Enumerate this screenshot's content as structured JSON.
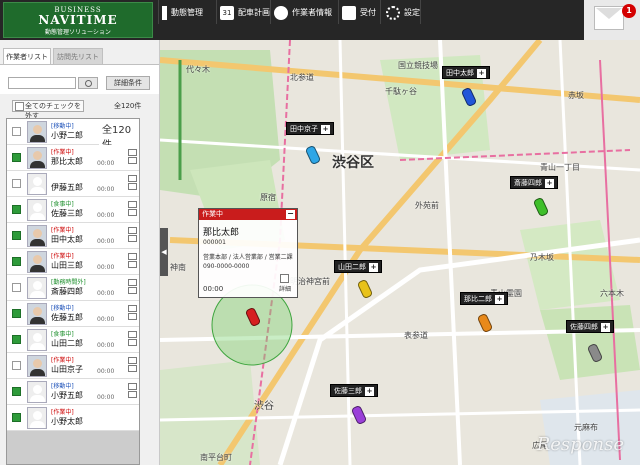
{
  "logo": {
    "line1": "BUSINESS",
    "line2": "NAVITIME",
    "line3": "動態管理ソリューション"
  },
  "nav": [
    {
      "label": "動態管理",
      "icon": "tracking-icon"
    },
    {
      "label": "配車計画",
      "icon": "calendar-icon"
    },
    {
      "label": "作業者情報",
      "icon": "person-icon"
    },
    {
      "label": "受付",
      "icon": "reception-icon"
    },
    {
      "label": "設定",
      "icon": "gear-icon"
    }
  ],
  "notifications": {
    "count": "1"
  },
  "sidebar": {
    "tabs": [
      "作業者リスト",
      "訪問先リスト"
    ],
    "detail_button": "詳細条件",
    "check_all": "全てのチェックを外す",
    "total_label": "全120件",
    "count_box": "全120件",
    "workers": [
      {
        "status": "[移動中]",
        "name": "小野二郎",
        "time": "",
        "checked": false,
        "photo": true
      },
      {
        "status": "[作業中]",
        "name": "那比太郎",
        "time": "00:00",
        "checked": true,
        "photo": true
      },
      {
        "status": "",
        "name": "伊藤五郎",
        "time": "00:00",
        "checked": false,
        "photo": false
      },
      {
        "status": "[食事中]",
        "name": "佐藤三郎",
        "time": "00:00",
        "checked": true,
        "photo": false
      },
      {
        "status": "[作業中]",
        "name": "田中太郎",
        "time": "00:00",
        "checked": true,
        "photo": true
      },
      {
        "status": "[作業中]",
        "name": "山田三郎",
        "time": "00:00",
        "checked": true,
        "photo": true
      },
      {
        "status": "[勤務時間外]",
        "name": "斎藤四郎",
        "time": "00:00",
        "checked": false,
        "photo": false
      },
      {
        "status": "[移動中]",
        "name": "佐藤五郎",
        "time": "00:00",
        "checked": true,
        "photo": true
      },
      {
        "status": "[食事中]",
        "name": "山田二郎",
        "time": "00:00",
        "checked": true,
        "photo": false
      },
      {
        "status": "[作業中]",
        "name": "山田京子",
        "time": "00:00",
        "checked": false,
        "photo": true
      },
      {
        "status": "[移動中]",
        "name": "小野五郎",
        "time": "00:00",
        "checked": true,
        "photo": false
      },
      {
        "status": "[作業中]",
        "name": "小野太郎",
        "time": "",
        "checked": true,
        "photo": false
      }
    ]
  },
  "map": {
    "district": "渋谷区",
    "areas": [
      "代々木",
      "北参道",
      "国立競技場",
      "千駄ヶ谷",
      "原宿",
      "明治神宮前",
      "神南",
      "渋谷",
      "青山一丁目",
      "外苑前",
      "乃木坂",
      "六本木",
      "表参道",
      "南平台町",
      "広尾",
      "元麻布",
      "青山霊園",
      "赤坂"
    ],
    "vehicles": [
      {
        "label": "田中太郎",
        "color": "#2156d8"
      },
      {
        "label": "田中京子",
        "color": "#2ea6e6"
      },
      {
        "label": "斎藤四郎",
        "color": "#3fbf2a"
      },
      {
        "label": "山田二郎",
        "color": "#e8c21a"
      },
      {
        "label": "那比二郎",
        "color": "#e8891a"
      },
      {
        "label": "佐藤四郎",
        "color": "#8a8a8a"
      },
      {
        "label": "佐藤三郎",
        "color": "#9a3fd8"
      }
    ],
    "popup": {
      "status": "作業中",
      "name": "那比太郎",
      "id": "000001",
      "dept": "営業本部 / 法人営業部 / 営業二課",
      "tel": "090-0000-0000",
      "time": "00:00",
      "doc": "詳細"
    },
    "watermark": "Response"
  }
}
